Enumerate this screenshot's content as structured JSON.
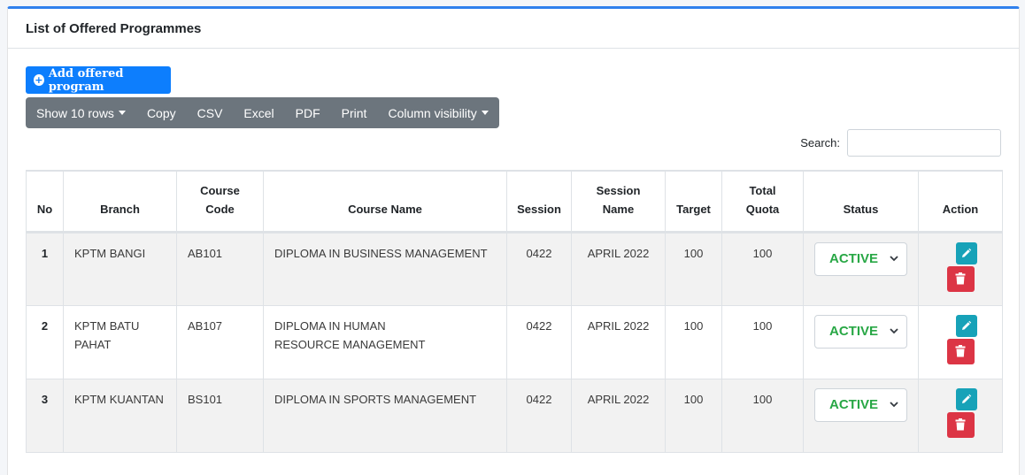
{
  "card": {
    "title": "List of Offered Programmes"
  },
  "toolbar": {
    "add_label": "Add offered program",
    "buttons": [
      "Show 10 rows",
      "Copy",
      "CSV",
      "Excel",
      "PDF",
      "Print",
      "Column visibility"
    ]
  },
  "search": {
    "label": "Search:",
    "value": ""
  },
  "table": {
    "headers": [
      "No",
      "Branch",
      "Course Code",
      "Course Name",
      "Session",
      "Session Name",
      "Target",
      "Total Quota",
      "Status",
      "Action"
    ],
    "rows": [
      {
        "no": "1",
        "branch": "KPTM BANGI",
        "code": "AB101",
        "name": "DIPLOMA IN BUSINESS MANAGEMENT",
        "session": "0422",
        "session_name": "APRIL 2022",
        "target": "100",
        "quota": "100",
        "status": "ACTIVE"
      },
      {
        "no": "2",
        "branch": "KPTM BATU PAHAT",
        "code": "AB107",
        "name": "DIPLOMA IN HUMAN RESOURCE MANAGEMENT",
        "session": "0422",
        "session_name": "APRIL 2022",
        "target": "100",
        "quota": "100",
        "status": "ACTIVE"
      },
      {
        "no": "3",
        "branch": "KPTM KUANTAN",
        "code": "BS101",
        "name": "DIPLOMA IN SPORTS MANAGEMENT",
        "session": "0422",
        "session_name": "APRIL 2022",
        "target": "100",
        "quota": "100",
        "status": "ACTIVE"
      }
    ]
  },
  "colors": {
    "accent": "#2f80ed",
    "primary": "#0d7efd",
    "toolbar": "#6c757d",
    "active": "#28a745",
    "edit": "#17a2b8",
    "delete": "#dc3545"
  }
}
